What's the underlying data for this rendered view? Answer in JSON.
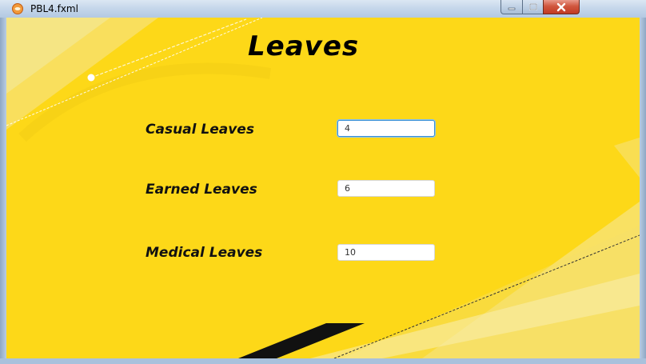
{
  "window": {
    "title": "PBL4.fxml"
  },
  "form": {
    "heading": "Leaves",
    "fields": [
      {
        "label": "Casual Leaves",
        "value": "4"
      },
      {
        "label": "Earned Leaves",
        "value": "6"
      },
      {
        "label": "Medical Leaves",
        "value": "10"
      }
    ]
  },
  "colors": {
    "background": "#fdd818",
    "accent_stripe": "#f2e27a",
    "focus_border": "#3b8fd0"
  },
  "icons": {
    "app": "java-cup-icon",
    "minimize": "minimize-icon",
    "maximize": "maximize-icon",
    "close": "close-icon"
  }
}
